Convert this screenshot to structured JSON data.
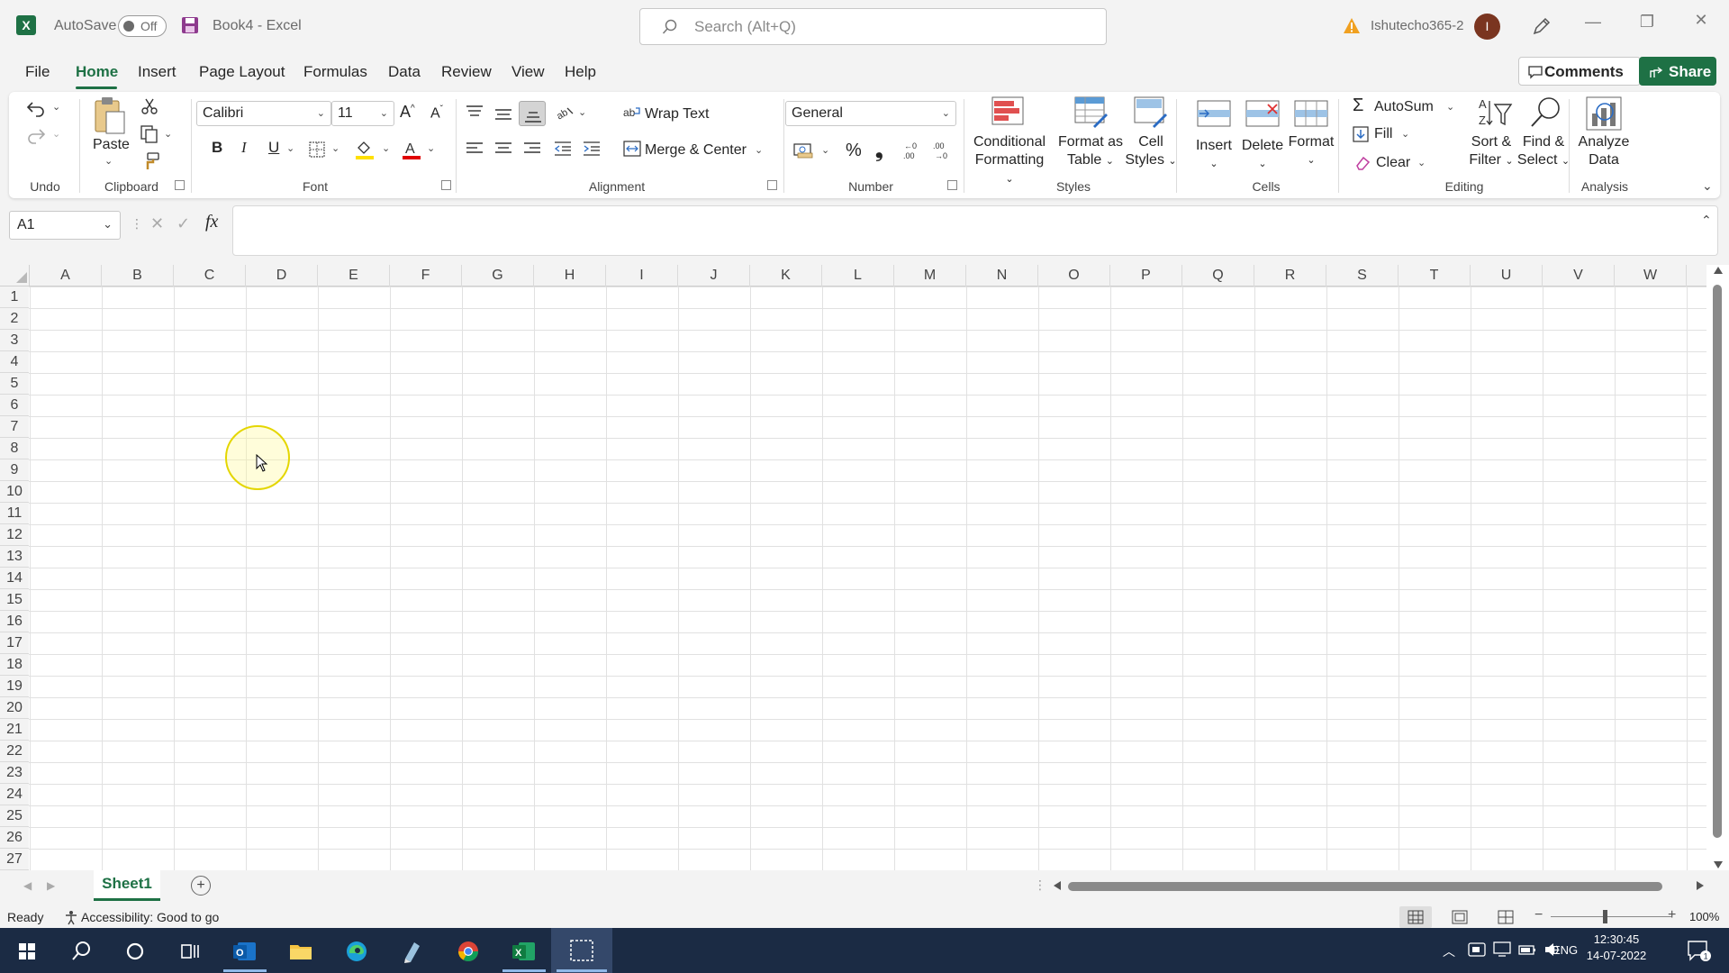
{
  "titlebar": {
    "autosave_label": "AutoSave",
    "autosave_state": "Off",
    "doc_title": "Book4  -  Excel",
    "search_placeholder": "Search (Alt+Q)",
    "user": "Ishutecho365-2",
    "avatar_initial": "I"
  },
  "tabs": [
    "File",
    "Home",
    "Insert",
    "Page Layout",
    "Formulas",
    "Data",
    "Review",
    "View",
    "Help"
  ],
  "header_buttons": {
    "comments": "Comments",
    "share": "Share"
  },
  "ribbon": {
    "groups": {
      "undo": "Undo",
      "clipboard": "Clipboard",
      "font": "Font",
      "alignment": "Alignment",
      "number": "Number",
      "styles": "Styles",
      "cells": "Cells",
      "editing": "Editing",
      "analysis": "Analysis"
    },
    "paste": "Paste",
    "font_name": "Calibri",
    "font_size": "11",
    "bold": "B",
    "italic": "I",
    "underline": "U",
    "wrap_text": "Wrap Text",
    "merge_center": "Merge & Center",
    "number_format": "General",
    "percent": "%",
    "comma": "❟",
    "conditional_formatting": [
      "Conditional",
      "Formatting"
    ],
    "format_as_table": [
      "Format as",
      "Table"
    ],
    "cell_styles": [
      "Cell",
      "Styles"
    ],
    "insert": "Insert",
    "delete": "Delete",
    "format": "Format",
    "autosum": "AutoSum",
    "fill": "Fill",
    "clear": "Clear",
    "sort_filter": [
      "Sort &",
      "Filter"
    ],
    "find_select": [
      "Find &",
      "Select"
    ],
    "analyze_data": [
      "Analyze",
      "Data"
    ]
  },
  "formula_bar": {
    "name_box": "A1",
    "fx": "fx",
    "content": ""
  },
  "columns": [
    "A",
    "B",
    "C",
    "D",
    "E",
    "F",
    "G",
    "H",
    "I",
    "J",
    "K",
    "L",
    "M",
    "N",
    "O",
    "P",
    "Q",
    "R",
    "S",
    "T",
    "U",
    "V",
    "W"
  ],
  "rows": [
    "1",
    "2",
    "3",
    "4",
    "5",
    "6",
    "7",
    "8",
    "9",
    "10",
    "11",
    "12",
    "13",
    "14",
    "15",
    "16",
    "17",
    "18",
    "19",
    "20",
    "21",
    "22",
    "23",
    "24",
    "25",
    "26",
    "27"
  ],
  "sheets": [
    "Sheet1"
  ],
  "status": {
    "ready": "Ready",
    "accessibility": "Accessibility: Good to go",
    "zoom": "100%"
  },
  "taskbar": {
    "language": "ENG",
    "time": "12:30:45",
    "date": "14-07-2022",
    "notifications": "1"
  },
  "colors": {
    "excel_green": "#1e7145",
    "taskbar": "#1b2b44"
  }
}
